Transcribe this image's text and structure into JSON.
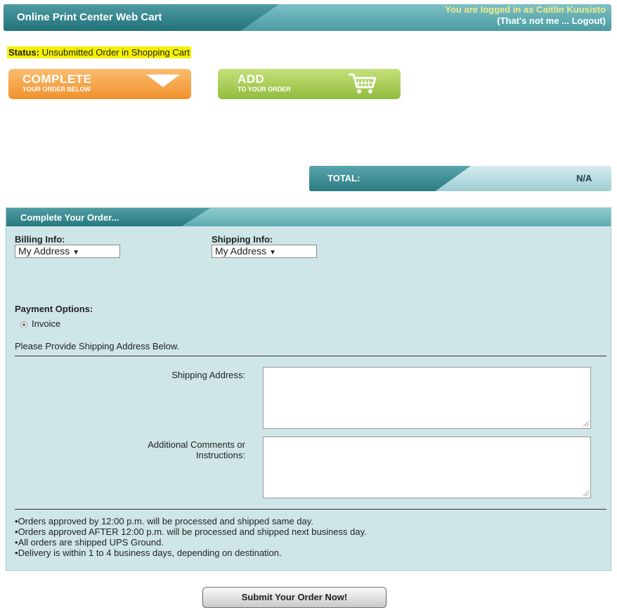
{
  "header": {
    "title": "Online Print Center Web Cart",
    "logged_in_text": "You are logged in as Caitlin Kuusisto",
    "not_me_link": "That's not me ... Logout",
    "bracket_open": "(",
    "bracket_close": ")"
  },
  "status": {
    "label": "Status:",
    "value": "Unsubmitted Order in Shopping Cart"
  },
  "actions": {
    "complete_big": "COMPLETE",
    "complete_small": "YOUR ORDER BELOW",
    "add_big": "ADD",
    "add_small": "TO YOUR ORDER"
  },
  "total": {
    "label": "TOTAL:",
    "value": "N/A"
  },
  "order_panel": {
    "title": "Complete Your Order...",
    "billing_label": "Billing Info:",
    "billing_value": "My Address",
    "shipping_label": "Shipping Info:",
    "shipping_value": "My Address",
    "payment_label": "Payment Options:",
    "payment_option": "Invoice",
    "shipping_note": "Please Provide Shipping Address Below.",
    "shipping_address_label": "Shipping Address:",
    "comments_label_1": "Additional Comments or",
    "comments_label_2": "Instructions:",
    "notices": [
      "Orders approved by 12:00 p.m. will be processed and shipped same day.",
      "Orders approved AFTER 12:00 p.m. will be processed and shipped next business day.",
      "All orders are shipped UPS Ground.",
      "Delivery is within 1 to 4 business days, depending on destination."
    ]
  },
  "submit_label": "Submit Your Order Now!",
  "colors": {
    "header_dark": "#22727a",
    "header_light": "#7cc1c6",
    "complete_orange": "#f0912d",
    "add_green": "#92bc3e",
    "status_highlight": "#f5f000",
    "panel_bg": "#cfe6e9"
  }
}
